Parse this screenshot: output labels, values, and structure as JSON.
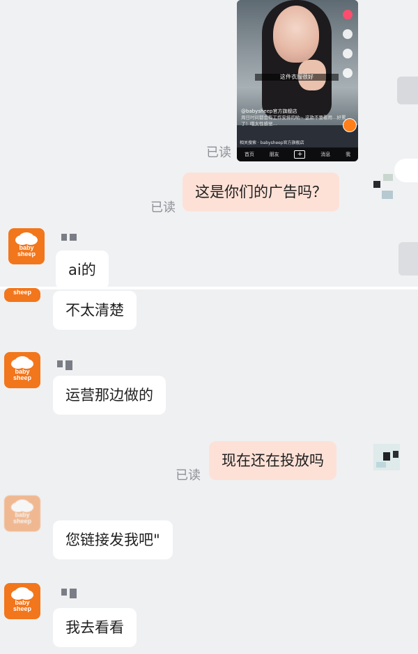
{
  "chat": {
    "messages": [
      {
        "id": "m0",
        "type": "image",
        "from": "me",
        "caption_handle": "@babysheep官方旗舰店",
        "caption_text": "周日时间都会有工作安排的哟~ 这款不要看用…好累了！哦太性感觉…",
        "search_text": "相关搜索 · babysheep官方旗舰店",
        "subtitle": "这件衣服很好",
        "tabs": [
          "首页",
          "朋友",
          "+",
          "消息",
          "我"
        ]
      },
      {
        "id": "m1",
        "type": "text",
        "from": "me",
        "text": "这是你们的广告吗？"
      },
      {
        "id": "m2",
        "type": "text",
        "from": "them",
        "text": "ai的"
      },
      {
        "id": "m3",
        "type": "text",
        "from": "them",
        "text": "不太清楚"
      },
      {
        "id": "m4",
        "type": "text",
        "from": "them",
        "text": "运营那边做的"
      },
      {
        "id": "m5",
        "type": "text",
        "from": "me",
        "text": "现在还在投放吗"
      },
      {
        "id": "m6",
        "type": "text",
        "from": "them",
        "text": "您链接发我吧\""
      },
      {
        "id": "m7",
        "type": "text",
        "from": "them",
        "text": "我去看看"
      }
    ],
    "read_label": "已读",
    "avatar_brand_line1": "baby",
    "avatar_brand_line2": "sheep"
  },
  "colors": {
    "background": "#eff0f2",
    "out_bubble": "#fde1d7",
    "in_bubble": "#ffffff",
    "avatar": "#f2761c",
    "read_text": "#8d9096"
  }
}
